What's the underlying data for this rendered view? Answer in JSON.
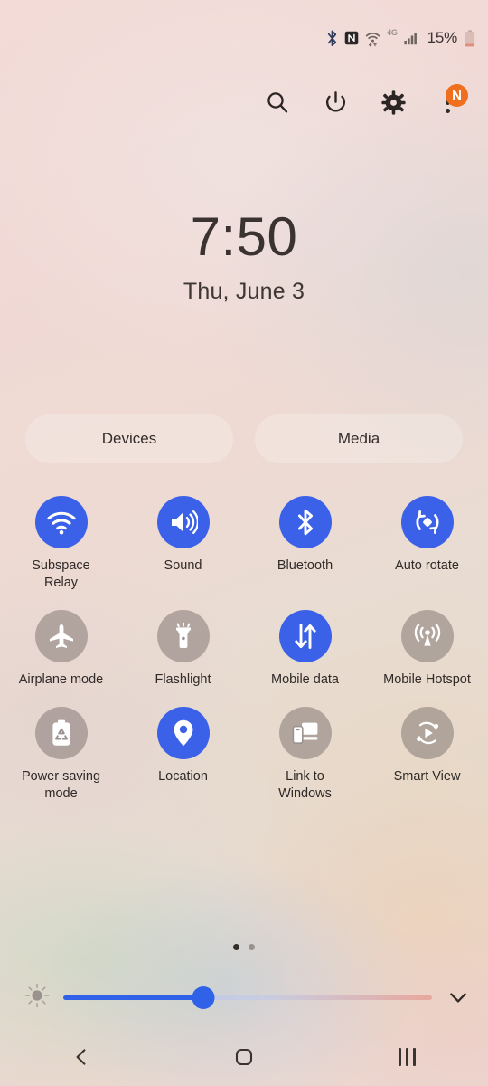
{
  "status_bar": {
    "icons": [
      "bluetooth-icon",
      "nfc-icon",
      "wifi-icon",
      "network-type-icon",
      "signal-icon"
    ],
    "network_type": "4G",
    "battery_percent": "15%"
  },
  "header": {
    "search_label": "search-icon",
    "power_label": "power-icon",
    "settings_label": "settings-icon",
    "more_label": "more-options-icon",
    "badge_text": "N"
  },
  "clock": {
    "time": "7:50",
    "date": "Thu, June 3"
  },
  "pills": [
    {
      "label": "Devices"
    },
    {
      "label": "Media"
    }
  ],
  "tiles": [
    {
      "label": "Subspace Relay",
      "icon": "wifi-icon",
      "state": "on"
    },
    {
      "label": "Sound",
      "icon": "sound-icon",
      "state": "on"
    },
    {
      "label": "Bluetooth",
      "icon": "bluetooth-icon",
      "state": "on"
    },
    {
      "label": "Auto rotate",
      "icon": "auto-rotate-icon",
      "state": "on"
    },
    {
      "label": "Airplane mode",
      "icon": "airplane-icon",
      "state": "off"
    },
    {
      "label": "Flashlight",
      "icon": "flashlight-icon",
      "state": "off"
    },
    {
      "label": "Mobile data",
      "icon": "mobile-data-icon",
      "state": "on"
    },
    {
      "label": "Mobile Hotspot",
      "icon": "hotspot-icon",
      "state": "off"
    },
    {
      "label": "Power saving mode",
      "icon": "power-saving-icon",
      "state": "off"
    },
    {
      "label": "Location",
      "icon": "location-pin-icon",
      "state": "on"
    },
    {
      "label": "Link to Windows",
      "icon": "link-to-windows-icon",
      "state": "off"
    },
    {
      "label": "Smart View",
      "icon": "smart-view-icon",
      "state": "off"
    }
  ],
  "pager": {
    "total_pages": 2,
    "active_page": 1
  },
  "brightness": {
    "icon": "brightness-icon",
    "value_percent": 38,
    "expand_icon": "chevron-down-icon"
  },
  "nav_bar": {
    "back_label": "back-icon",
    "home_label": "home-icon",
    "recents_label": "recents-icon"
  },
  "colors": {
    "accent_blue": "#3b61e8",
    "badge_orange": "#ef6f1e",
    "inactive_gray": "rgba(132,120,116,0.55)"
  }
}
